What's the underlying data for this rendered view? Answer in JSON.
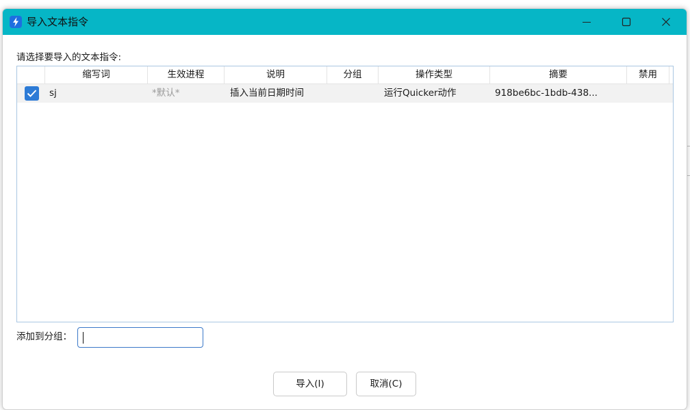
{
  "window": {
    "title": "导入文本指令"
  },
  "dialog": {
    "prompt": "请选择要导入的文本指令:",
    "columns": [
      "缩写词",
      "生效进程",
      "说明",
      "分组",
      "操作类型",
      "摘要",
      "禁用"
    ],
    "rows": [
      {
        "checked": true,
        "abbr": "sj",
        "process": "*默认*",
        "description": "插入当前日期时间",
        "group": "",
        "action_type": "运行Quicker动作",
        "summary": "918be6bc-1bdb-438...",
        "disabled": ""
      }
    ],
    "group_label": "添加到分组：",
    "group_input_value": "",
    "import_button": "导入(I)",
    "cancel_button": "取消(C)"
  },
  "colors": {
    "titlebar": "#06b6c6",
    "checkbox": "#2d7bd6",
    "input_border": "#3a78c8"
  },
  "icons": {
    "app": "quicker-bolt-icon",
    "minimize": "minimize-icon",
    "maximize": "maximize-icon",
    "close": "close-icon",
    "check": "check-icon"
  }
}
